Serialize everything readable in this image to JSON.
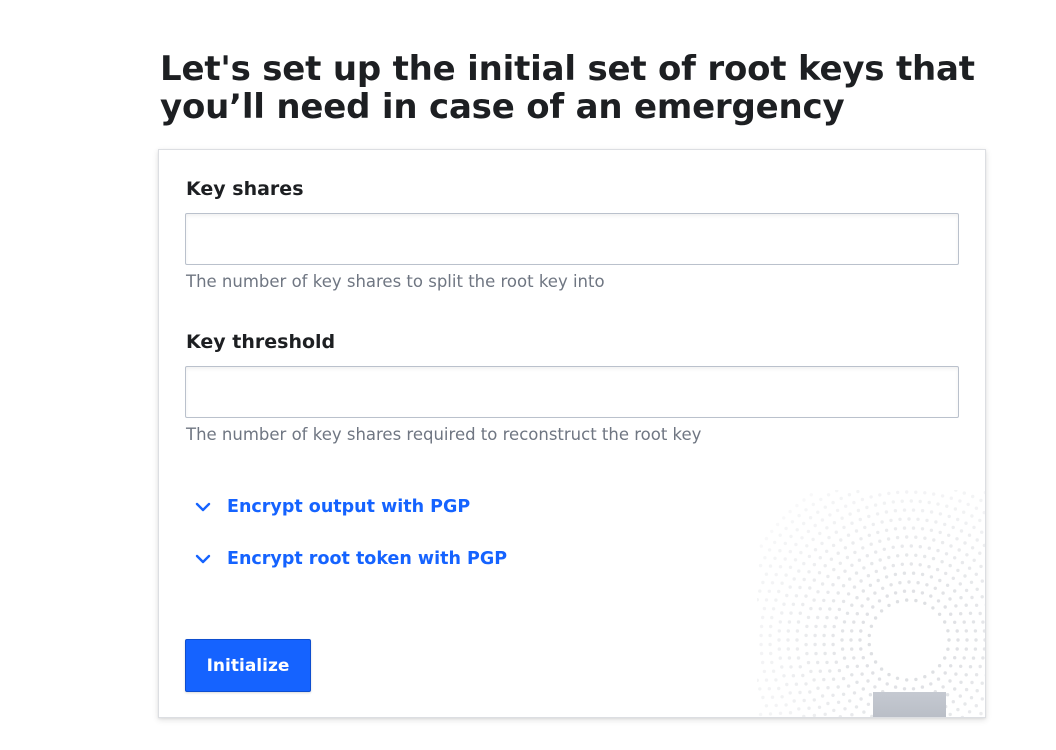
{
  "header": {
    "title": "Let's set up the initial set of root keys that you’ll need in case of an emergency"
  },
  "form": {
    "key_shares": {
      "label": "Key shares",
      "value": "",
      "help": "The number of key shares to split the root key into"
    },
    "key_threshold": {
      "label": "Key threshold",
      "value": "",
      "help": "The number of key shares required to reconstruct the root key"
    },
    "toggles": [
      {
        "label": "Encrypt output with PGP",
        "icon": "chevron-down-icon",
        "expanded": false
      },
      {
        "label": "Encrypt root token with PGP",
        "icon": "chevron-down-icon",
        "expanded": false
      }
    ],
    "submit_label": "Initialize"
  },
  "illustration": {
    "icon": "keyhole-shield-icon"
  },
  "colors": {
    "accent": "#1563ff",
    "help_text": "#6f7682",
    "shield": "#a9aeb8"
  }
}
